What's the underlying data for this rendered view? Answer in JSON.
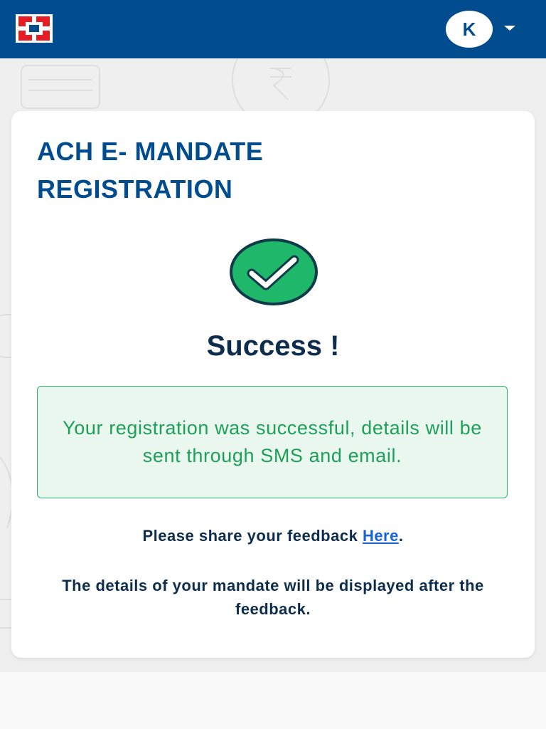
{
  "header": {
    "user_initial": "K",
    "brand_color": "#004c8f",
    "logo_icon": "bank-logo-icon",
    "menu_icon": "caret-down-icon"
  },
  "card": {
    "title_line1": "ACH E- MANDATE",
    "title_line2": "REGISTRATION",
    "status_icon": "check-circle-icon",
    "status_title": "Success !",
    "message": "Your registration was successful, details will be sent through SMS and email.",
    "feedback_prefix": "Please share your feedback ",
    "feedback_link": "Here",
    "feedback_suffix": ".",
    "details_note": "The details of your mandate will be displayed after the feedback."
  },
  "colors": {
    "success_green": "#1ea05a",
    "success_bg": "#e9f7ee",
    "heading_text": "#0e2d4d",
    "link": "#1565d8"
  }
}
